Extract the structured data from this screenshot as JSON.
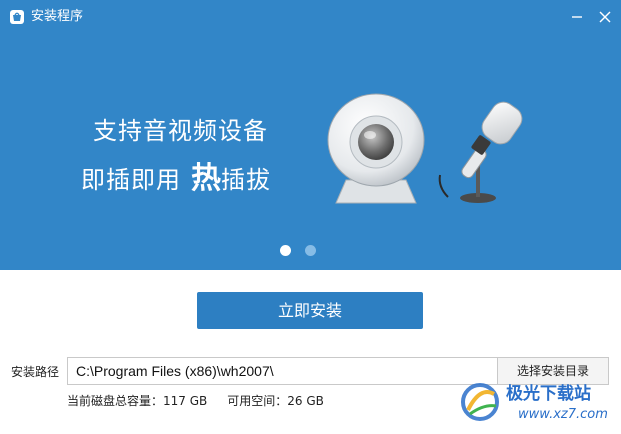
{
  "window": {
    "title": "安装程序",
    "icons": {
      "app": "app-store-icon",
      "minimize": "minimize-icon",
      "close": "close-icon"
    }
  },
  "banner": {
    "line1": "支持音视频设备",
    "line2_a": "即插即用",
    "line2_b": "热",
    "line2_c": "插拔",
    "illustration": [
      "webcam-icon",
      "microphone-icon"
    ],
    "carousel": {
      "pages": 2,
      "active": 1
    }
  },
  "actions": {
    "install_label": "立即安装"
  },
  "install_path": {
    "label": "安装路径",
    "value": "C:\\Program Files (x86)\\wh2007\\",
    "browse_label": "选择安装目录"
  },
  "disk": {
    "total_text": "当前磁盘总容量：117 GB",
    "free_text": "可用空间：26 GB"
  },
  "watermark": {
    "name": "极光下载站",
    "url": "www.xz7.com",
    "icon": "aurora-logo-icon"
  },
  "colors": {
    "banner_bg": "#3286c8",
    "button_bg": "#2d7fc2",
    "dot_inactive": "#86bce6",
    "watermark": "#2a6fc9"
  }
}
